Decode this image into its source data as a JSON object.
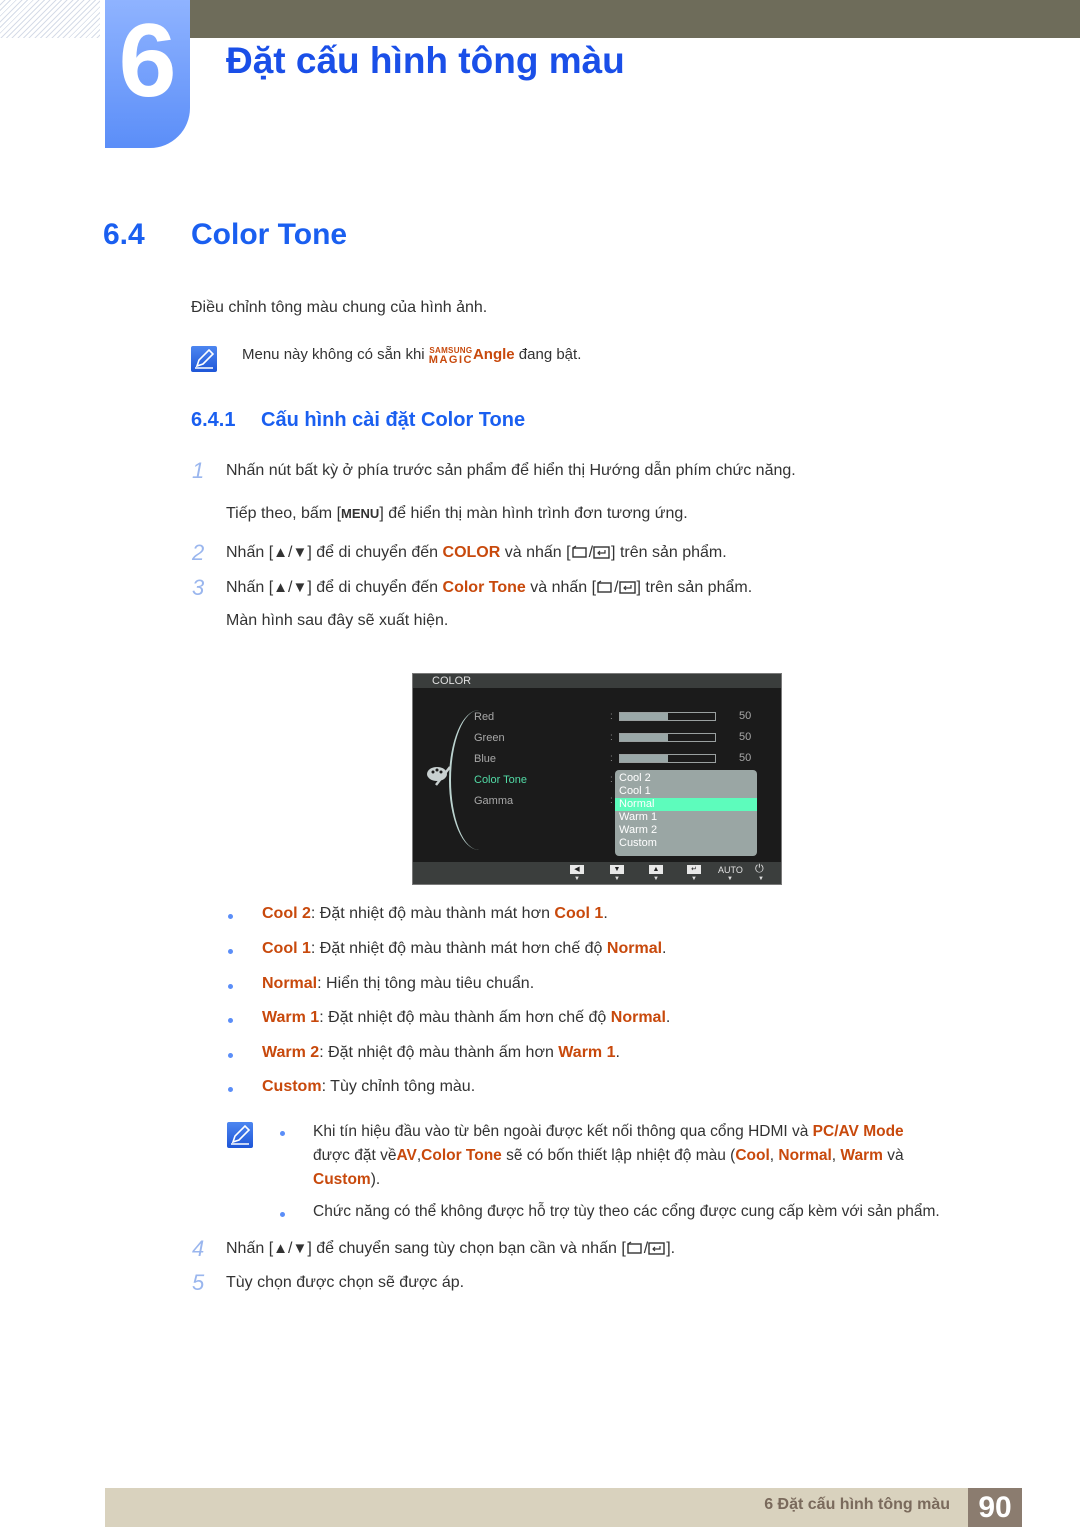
{
  "chapter": {
    "number": "6",
    "title": "Đặt cấu hình tông màu"
  },
  "section": {
    "number": "6.4",
    "title": "Color Tone",
    "intro": "Điều chỉnh tông màu chung của hình ảnh.",
    "note": {
      "before": "Menu này không có sẵn khi ",
      "brand_top": "SAMSUNG",
      "brand_bottom": "MAGIC",
      "brand_word": "Angle",
      "after": " đang bật."
    }
  },
  "subsection": {
    "number": "6.4.1",
    "title": "Cấu hình cài đặt Color Tone"
  },
  "steps": {
    "s1": {
      "num": "1",
      "text": "Nhấn nút bất kỳ ở phía trước sản phẩm để hiển thị Hướng dẫn phím chức năng."
    },
    "s1b": {
      "pre": "Tiếp theo, bấm [",
      "key": "MENU",
      "post": "] để hiển thị màn hình trình đơn tương ứng."
    },
    "s2": {
      "num": "2",
      "pre": "Nhấn [",
      "up": "▲",
      "slash": "/",
      "down": "▼",
      "mid": "] để di chuyển đến ",
      "target": "COLOR",
      "mid2": " và nhấn [",
      "post": "] trên sản phẩm."
    },
    "s3": {
      "num": "3",
      "pre": "Nhấn [",
      "up": "▲",
      "slash": "/",
      "down": "▼",
      "mid": "] để di chuyển đến ",
      "target": "Color Tone",
      "mid2": " và nhấn [",
      "post": "] trên sản phẩm."
    },
    "s3b": {
      "text": "Màn hình sau đây sẽ xuất hiện."
    },
    "s4": {
      "num": "4",
      "pre": "Nhấn [",
      "up": "▲",
      "slash": "/",
      "down": "▼",
      "mid": "] để chuyển sang tùy chọn bạn cần và nhấn [",
      "post": "]."
    },
    "s5": {
      "num": "5",
      "text": "Tùy chọn được chọn sẽ được áp."
    }
  },
  "osd": {
    "title": "COLOR",
    "items": [
      {
        "label": "Red",
        "value": "50",
        "fill": 0.5
      },
      {
        "label": "Green",
        "value": "50",
        "fill": 0.5
      },
      {
        "label": "Blue",
        "value": "50",
        "fill": 0.5
      },
      {
        "label": "Color Tone"
      },
      {
        "label": "Gamma"
      }
    ],
    "active_item": "Color Tone",
    "options": [
      "Cool 2",
      "Cool 1",
      "Normal",
      "Warm 1",
      "Warm 2",
      "Custom"
    ],
    "selected_option": "Normal",
    "footer_buttons": [
      "◀",
      "▼",
      "▲",
      "↵",
      "AUTO",
      "⏻"
    ]
  },
  "options_desc": [
    {
      "name": "Cool 2",
      "sep": ": Đặt nhiệt độ màu thành mát hơn ",
      "ref": "Cool 1",
      "end": "."
    },
    {
      "name": "Cool 1",
      "sep": ": Đặt nhiệt độ màu thành mát hơn chế độ ",
      "ref": "Normal",
      "end": "."
    },
    {
      "name": "Normal",
      "sep": ": Hiển thị tông màu tiêu chuẩn.",
      "ref": "",
      "end": ""
    },
    {
      "name": "Warm 1",
      "sep": ": Đặt nhiệt độ màu thành ấm hơn chế độ ",
      "ref": "Normal",
      "end": "."
    },
    {
      "name": "Warm 2",
      "sep": ": Đặt nhiệt độ màu thành ấm hơn ",
      "ref": "Warm 1",
      "end": "."
    },
    {
      "name": "Custom",
      "sep": ": Tùy chỉnh tông màu.",
      "ref": "",
      "end": ""
    }
  ],
  "notes": {
    "n1_line1_pre": "Khi tín hiệu đầu vào từ bên ngoài được kết nối thông qua cổng HDMI và ",
    "n1_line1_hl": "PC/AV Mode",
    "n1_line2_pre": "được đặt về",
    "n1_line2_av": "AV",
    "n1_line2_comma": ",",
    "n1_line2_ct": "Color Tone",
    "n1_line2_mid": " sẽ có bốn thiết lập nhiệt độ màu (",
    "n1_cool": "Cool",
    "n1_c1": ", ",
    "n1_normal": "Normal",
    "n1_c2": ", ",
    "n1_warm": "Warm",
    "n1_va": " và",
    "n1_custom": "Custom",
    "n1_end": ").",
    "n2": "Chức năng có thể không được hỗ trợ tùy theo các cổng được cung cấp kèm với sản phẩm."
  },
  "footer": {
    "text": "6 Đặt cấu hình tông màu",
    "page": "90"
  },
  "colors": {
    "heading_blue": "#1a5ff0",
    "highlight_orange": "#c8490c",
    "osd_active": "#52dba6",
    "osd_selected": "#5dfcbc"
  }
}
